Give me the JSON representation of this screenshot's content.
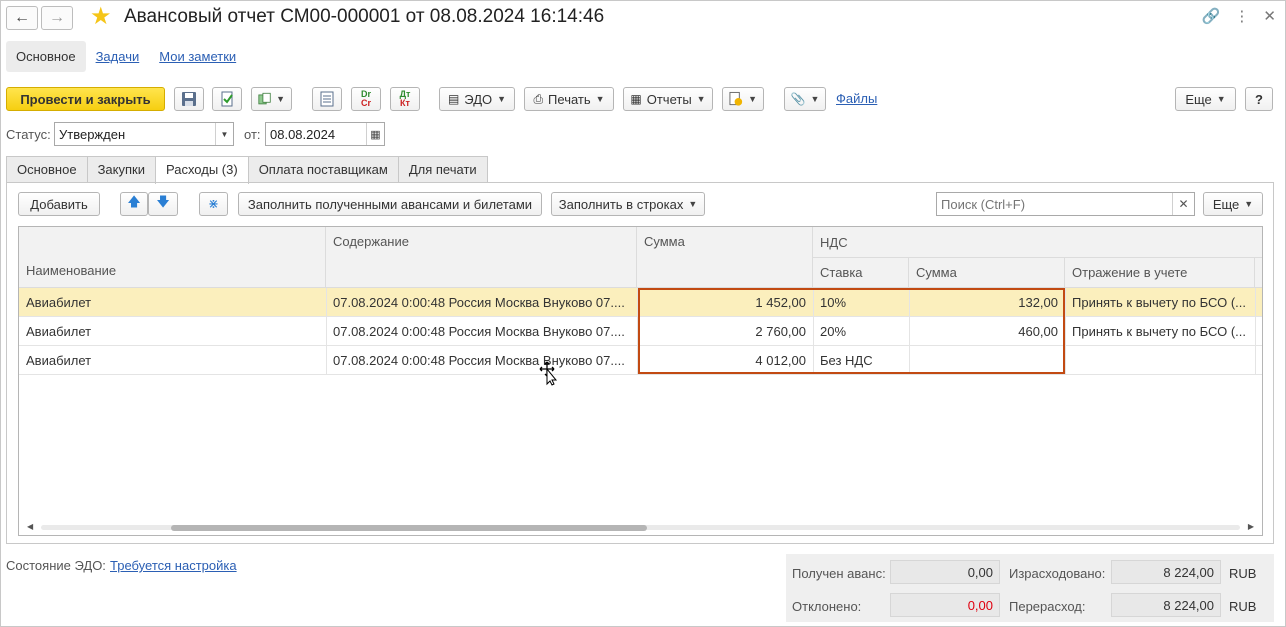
{
  "window": {
    "title": "Авансовый отчет СМ00-000001 от 08.08.2024 16:14:46"
  },
  "section_tabs": [
    "Основное",
    "Задачи",
    "Мои заметки"
  ],
  "toolbar": {
    "post_close": "Провести и закрыть",
    "edo": "ЭДО",
    "print": "Печать",
    "reports": "Отчеты",
    "files": "Файлы",
    "more": "Еще",
    "help": "?",
    "dt_top": "Dr",
    "dt_bottom": "Cr",
    "kt_top": "Дт",
    "kt_bottom": "Кт"
  },
  "status": {
    "label": "Статус:",
    "value": "Утвержден",
    "from_label": "от:",
    "date": "08.08.2024"
  },
  "page_tabs": [
    "Основное",
    "Закупки",
    "Расходы (3)",
    "Оплата поставщикам",
    "Для печати"
  ],
  "grid_toolbar": {
    "add": "Добавить",
    "fill_advances": "Заполнить полученными авансами и билетами",
    "fill_rows": "Заполнить в строках",
    "search_placeholder": "Поиск (Ctrl+F)",
    "more": "Еще"
  },
  "columns": {
    "name": "Наименование",
    "content": "Содержание",
    "amount": "Сумма",
    "vat": "НДС",
    "vat_rate": "Ставка",
    "vat_amount": "Сумма",
    "accounting": "Отражение в учете"
  },
  "rows": [
    {
      "name": "Авиабилет",
      "content": "07.08.2024 0:00:48 Россия Москва Внуково 07....",
      "amount": "1 452,00",
      "rate": "10%",
      "vat": "132,00",
      "accounting": "Принять к вычету по БСО (..."
    },
    {
      "name": "Авиабилет",
      "content": "07.08.2024 0:00:48 Россия Москва Внуково 07....",
      "amount": "2 760,00",
      "rate": "20%",
      "vat": "460,00",
      "accounting": "Принять к вычету по БСО (..."
    },
    {
      "name": "Авиабилет",
      "content": "07.08.2024 0:00:48 Россия Москва Внуково 07....",
      "amount": "4 012,00",
      "rate": "Без НДС",
      "vat": "",
      "accounting": ""
    }
  ],
  "footer": {
    "edo_label": "Состояние ЭДО:",
    "edo_link": "Требуется настройка",
    "advance_label": "Получен аванс:",
    "advance_value": "0,00",
    "rejected_label": "Отклонено:",
    "rejected_value": "0,00",
    "spent_label": "Израсходовано:",
    "spent_value": "8 224,00",
    "overspent_label": "Перерасход:",
    "overspent_value": "8 224,00",
    "currency1": "RUB",
    "currency2": "RUB"
  },
  "colors": {
    "primary_button": "#f6cf11",
    "selected_row": "#fbefbd",
    "highlight_box": "#c24a12",
    "link": "#2b5fb4",
    "rejected_value": "#e0000f"
  }
}
